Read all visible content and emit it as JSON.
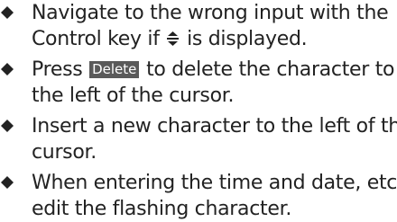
{
  "bullet_icon": "filled-diamond",
  "text_color": "#222222",
  "key_badge_color": "#5a5a5a",
  "items": [
    {
      "line1_before": "Navigate to the wrong input with the",
      "line2_before": "Control key if ",
      "control_key_icon": "up-down-arrow-icon",
      "line2_after": " is displayed."
    },
    {
      "line1_before": "Press ",
      "key_label": "Delete",
      "line1_after": " to delete the character to",
      "line2": "the left of the cursor."
    },
    {
      "line1": "Insert a new character to the left of the",
      "line2": "cursor."
    },
    {
      "line1": "When entering the time and date, etc.,",
      "line2": "edit the flashing character."
    }
  ]
}
